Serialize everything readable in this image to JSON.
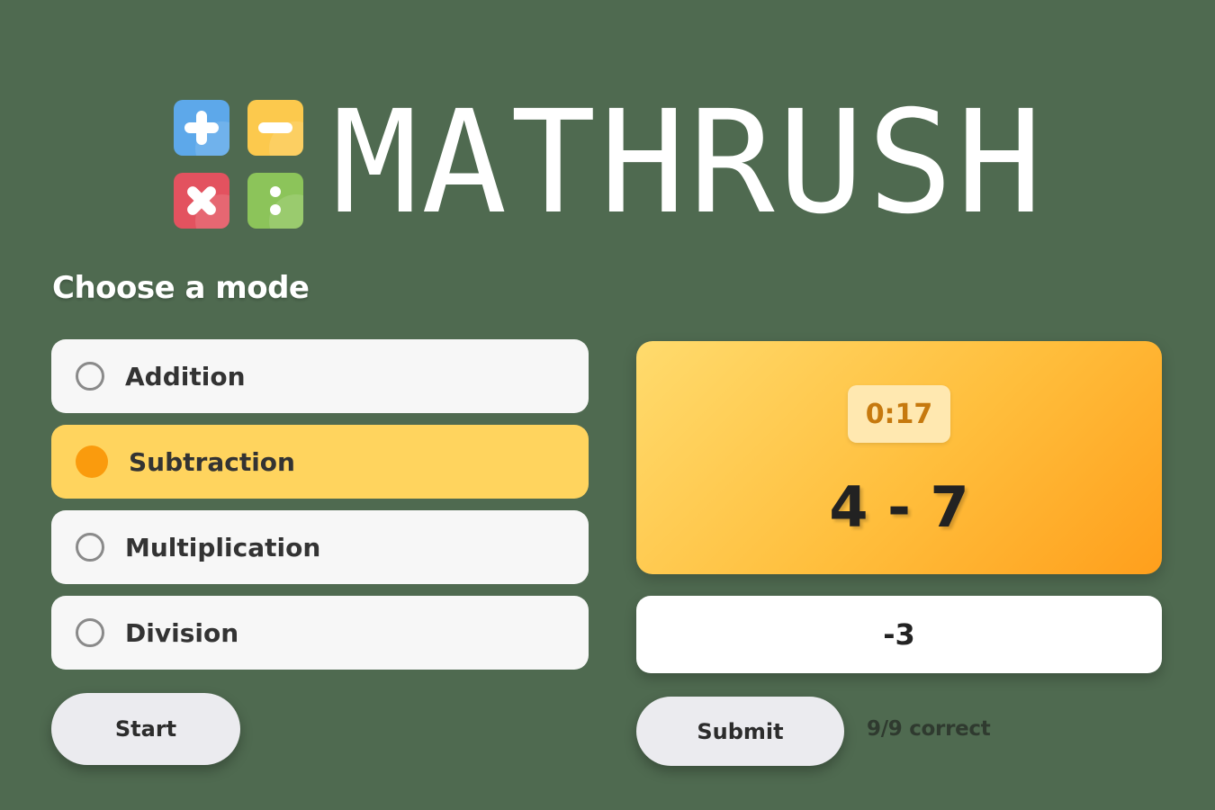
{
  "app": {
    "title": "MATHRUSH"
  },
  "logo": {
    "icons": [
      "plus-icon",
      "minus-icon",
      "times-icon",
      "divide-icon"
    ],
    "tile_colors": {
      "plus": "#5da8ea",
      "minus": "#fcc94d",
      "times": "#e3525f",
      "divide": "#8cc45a"
    }
  },
  "mode_picker": {
    "heading": "Choose a mode",
    "options": [
      {
        "label": "Addition",
        "selected": false
      },
      {
        "label": "Subtraction",
        "selected": true
      },
      {
        "label": "Multiplication",
        "selected": false
      },
      {
        "label": "Division",
        "selected": false
      }
    ],
    "start_label": "Start"
  },
  "question": {
    "timer": "0:17",
    "problem": "4 - 7"
  },
  "answer": {
    "value": "-3",
    "submit_label": "Submit"
  },
  "score": {
    "text": "9/9 correct"
  },
  "colors": {
    "background": "#4f6a50",
    "selected_option": "#ffd45e",
    "selected_radio": "#fa9b0d",
    "card_gradient_start": "#ffdb6d",
    "card_gradient_end": "#ff9f1c",
    "timer_text": "#c6790e"
  }
}
